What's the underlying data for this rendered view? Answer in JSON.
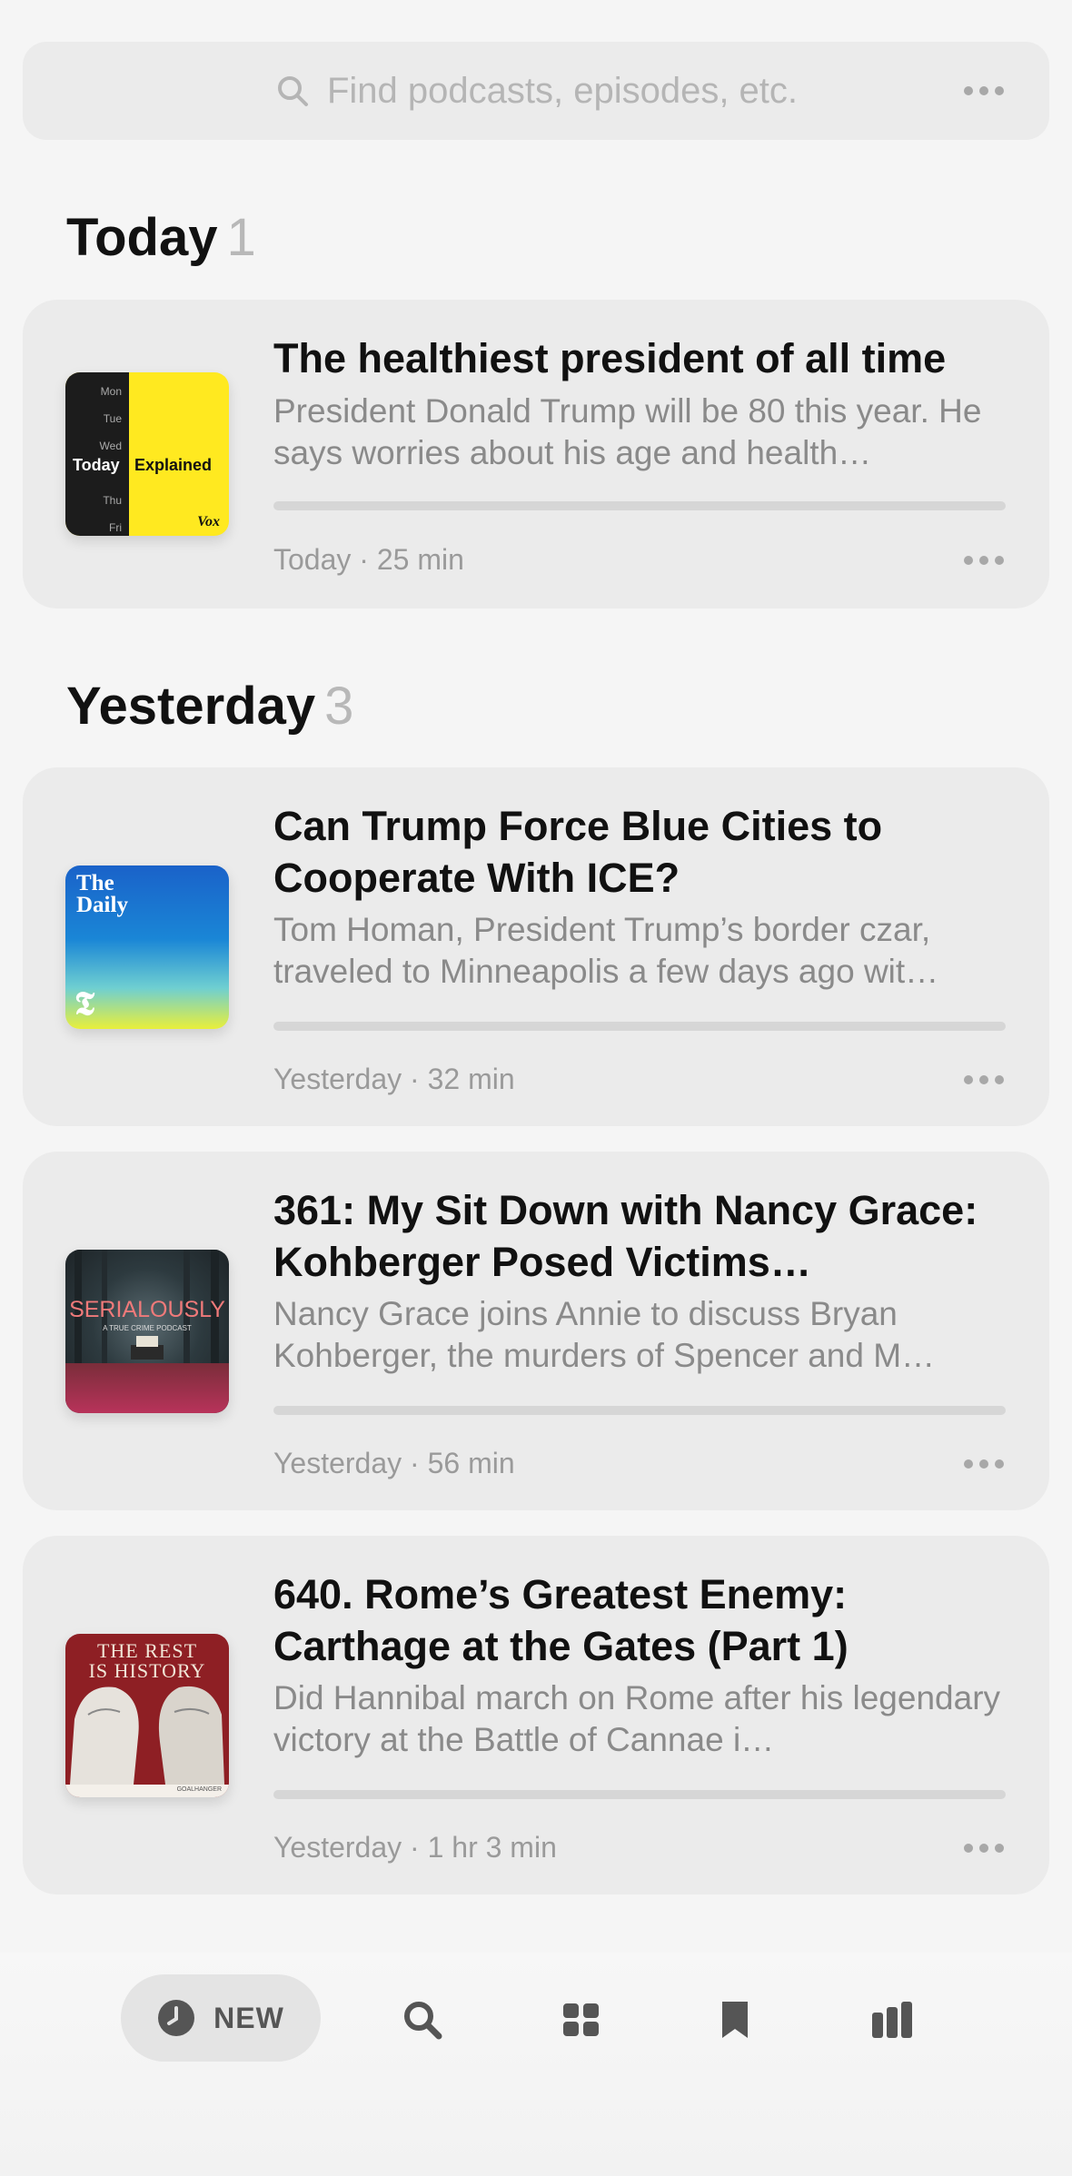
{
  "search": {
    "placeholder": "Find podcasts, episodes, etc."
  },
  "sections": [
    {
      "title": "Today",
      "count": "1",
      "episodes": [
        {
          "title": "The healthiest president of all time",
          "description": "President Donald Trump will be 80 this year. He says worries about his age and health…",
          "meta": "Today · 25 min",
          "progress": 0,
          "artwork": {
            "name": "Today Explained",
            "days": [
              "Mon",
              "Tue",
              "Wed",
              "Thu",
              "Fri"
            ],
            "text_left": "Today",
            "text_right": "Explained",
            "brand": "Vox"
          }
        }
      ]
    },
    {
      "title": "Yesterday",
      "count": "3",
      "episodes": [
        {
          "title": "Can Trump Force Blue Cities to Cooperate With ICE?",
          "description": "Tom Homan, President Trump’s border czar, traveled to Minneapolis a few days ago wit…",
          "meta": "Yesterday · 32 min",
          "progress": 0,
          "artwork": {
            "line1": "The",
            "line2": "Daily",
            "logo": "𝕿"
          }
        },
        {
          "title": "361: My Sit Down with Nancy Grace: Kohberger Posed Victims…",
          "description": "Nancy Grace joins Annie to discuss Bryan Kohberger, the murders of Spencer and M…",
          "meta": "Yesterday · 56 min",
          "progress": 0,
          "artwork": {
            "title": "SERIALOUSLY",
            "subtitle": "A TRUE CRIME PODCAST"
          }
        },
        {
          "title": "640. Rome’s Greatest Enemy: Carthage at the Gates (Part 1)",
          "description": "Did Hannibal march on Rome after his legendary victory at the Battle of Cannae i…",
          "meta": "Yesterday · 1 hr 3 min",
          "progress": 0,
          "artwork": {
            "line1": "THE REST",
            "line2": "IS HISTORY",
            "footer": "GOALHANGER"
          }
        }
      ]
    }
  ],
  "tabbar": {
    "new_label": "NEW"
  },
  "colors": {
    "background": "#f5f5f5",
    "card": "#ebebeb",
    "secondary_text": "#8a8a8a"
  }
}
